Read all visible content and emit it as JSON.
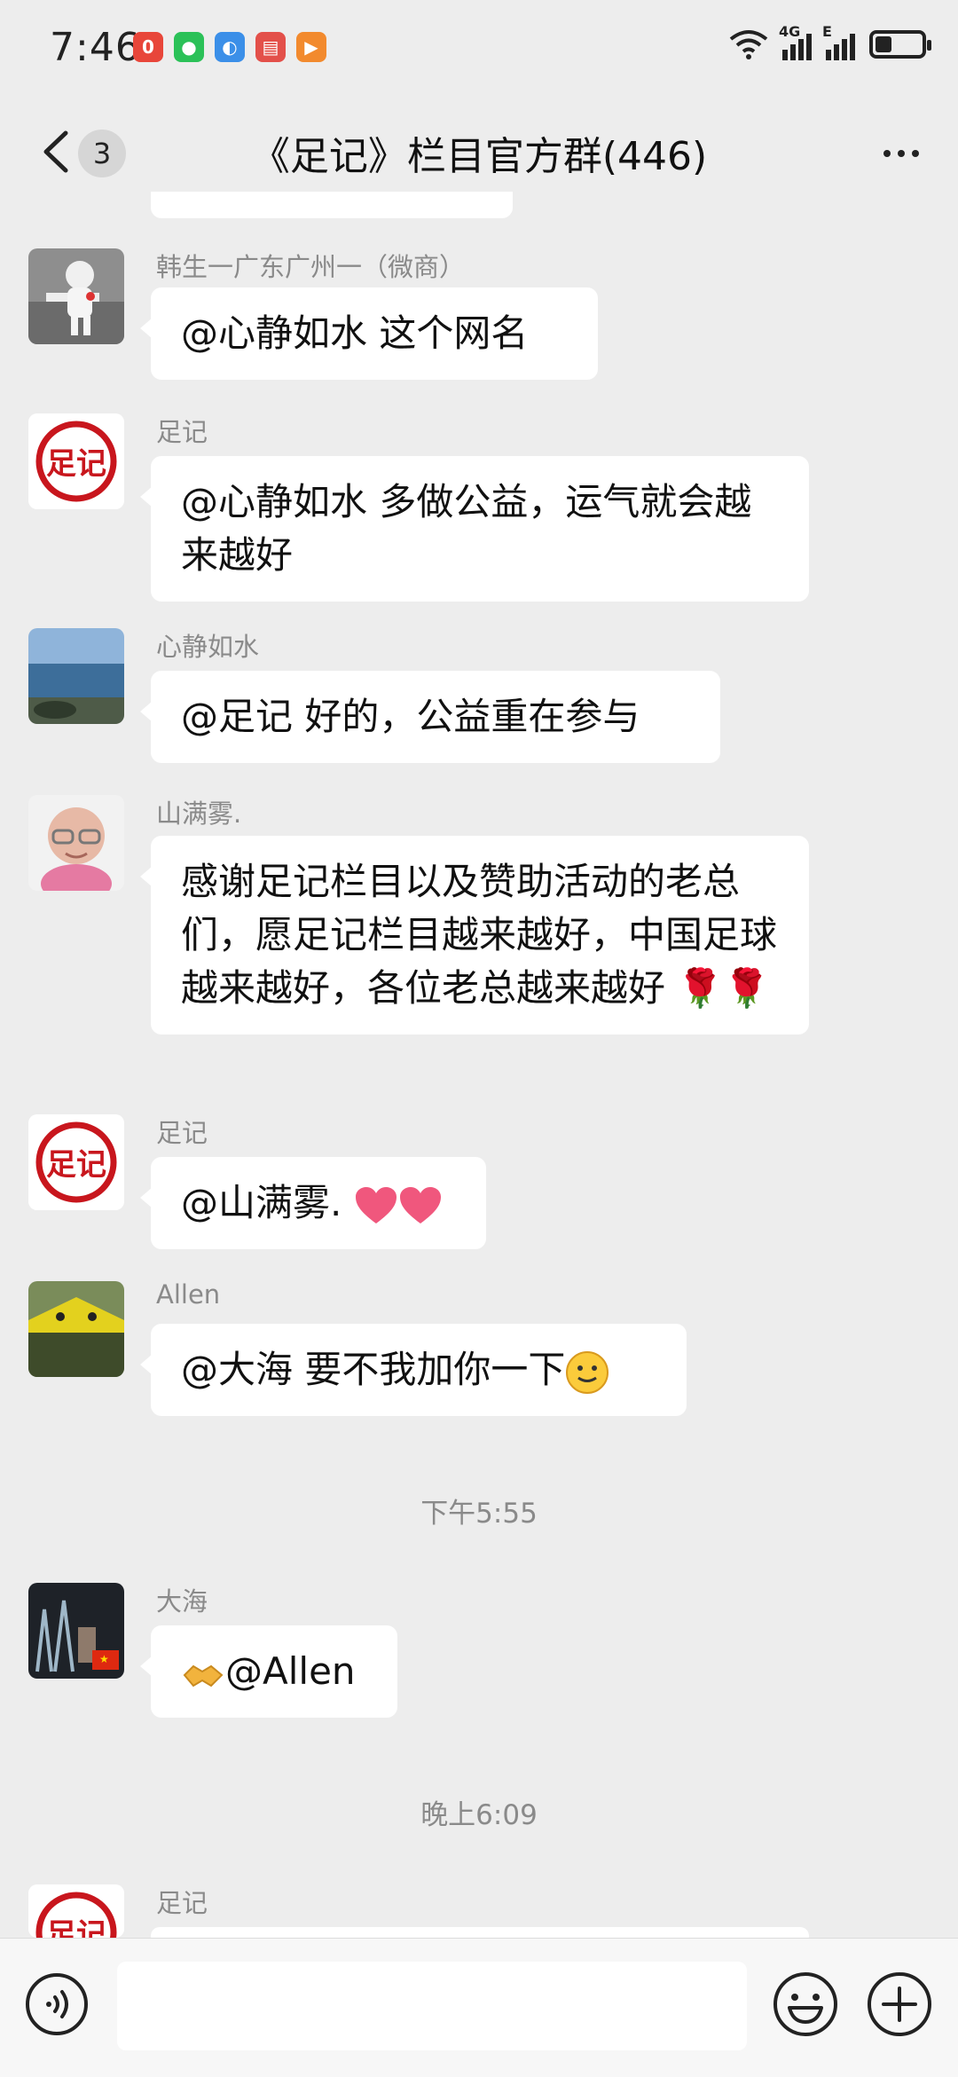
{
  "status_bar": {
    "time": "7:46",
    "network_4g": "4G",
    "network_e": "E",
    "battery_level_percent": 35
  },
  "header": {
    "unread_count": "3",
    "title": "《足记》栏目官方群(446)"
  },
  "messages": [
    {
      "sender": "韩生一广东广州一（微商）",
      "text": "@心静如水  这个网名"
    },
    {
      "sender": "足记",
      "text": "@心静如水  多做公益，运气就会越来越好"
    },
    {
      "sender": "心静如水",
      "text": "@足记  好的，公益重在参与"
    },
    {
      "sender": "山满雾.",
      "text": "感谢足记栏目以及赞助活动的老总们，愿足记栏目越来越好，中国足球越来越好，各位老总越来越好",
      "trailing_emoji": "🌹🌹"
    },
    {
      "sender": "足记",
      "text": "@山满雾. "
    },
    {
      "sender": "Allen",
      "text": "@大海  要不我加你一下"
    },
    {
      "sender": "大海",
      "text": "@Allen"
    },
    {
      "sender": "足记",
      "text": ""
    }
  ],
  "dividers": [
    "下午5:55",
    "晚上6:09"
  ],
  "avatar_logo_text": "足记",
  "colors": {
    "background": "#EDEDED",
    "bubble": "#FFFFFF",
    "brand_red": "#C8161D"
  },
  "icons": {
    "back": "chevron-left-icon",
    "more": "more-dots-icon",
    "voice": "voice-icon",
    "emoji": "emoji-icon",
    "plus": "plus-icon"
  }
}
